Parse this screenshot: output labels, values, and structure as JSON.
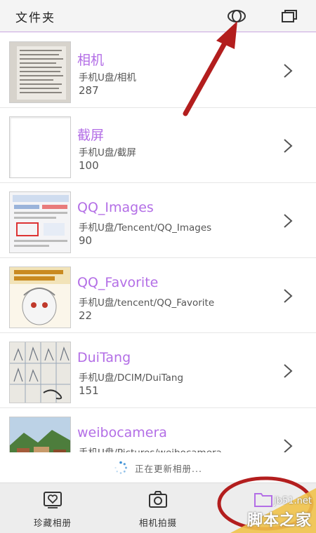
{
  "header": {
    "title": "文件夹",
    "view_icon": "eye-icon",
    "window_icon": "windows-icon"
  },
  "albums": [
    {
      "name": "相机",
      "path": "手机U盘/相机",
      "count": "287",
      "thumb": "document-photo"
    },
    {
      "name": "截屏",
      "path": "手机U盘/截屏",
      "count": "100",
      "thumb": "blank-screenshot"
    },
    {
      "name": "QQ_Images",
      "path": "手机U盘/Tencent/QQ_Images",
      "count": "90",
      "thumb": "screenshot-collage"
    },
    {
      "name": "QQ_Favorite",
      "path": "手机U盘/tencent/QQ_Favorite",
      "count": "22",
      "thumb": "anime-girl"
    },
    {
      "name": "DuiTang",
      "path": "手机U盘/DCIM/DuiTang",
      "count": "151",
      "thumb": "sketch-grid"
    },
    {
      "name": "weibocamera",
      "path": "手机U盘/Pictures/weibocamera",
      "count": "",
      "thumb": "landscape-photo"
    }
  ],
  "status": {
    "text": "正在更新相册..."
  },
  "tabs": [
    {
      "label": "珍藏相册",
      "icon": "heart-album-icon"
    },
    {
      "label": "相机拍摄",
      "icon": "camera-icon"
    },
    {
      "label": "",
      "icon": "folder-icon"
    }
  ],
  "watermark": {
    "site": "jb51.net",
    "name": "脚本之家"
  },
  "colors": {
    "accent": "#b36ee6",
    "annotation": "#b31e1e",
    "header_bg": "#f4f4f4",
    "tabbar_bg": "#ededed"
  }
}
